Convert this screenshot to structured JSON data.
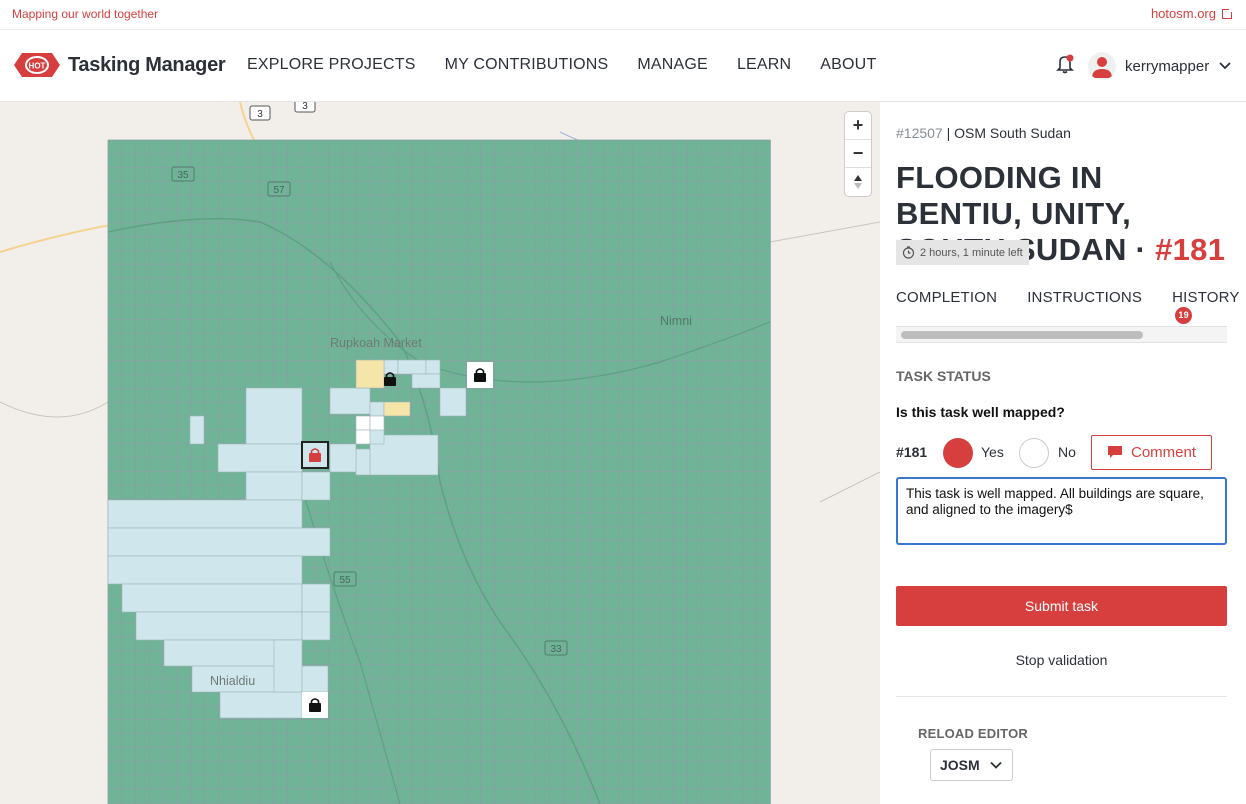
{
  "top": {
    "tagline": "Mapping our world together",
    "hotosm": "hotosm.org"
  },
  "header": {
    "brand": "Tasking Manager",
    "logo_text": "HOT",
    "nav": [
      "EXPLORE PROJECTS",
      "MY CONTRIBUTIONS",
      "MANAGE",
      "LEARN",
      "ABOUT"
    ],
    "username": "kerrymapper"
  },
  "map": {
    "labels": {
      "town1": "Rupkoah Market",
      "town2": "Nimni",
      "town3": "Nhialdiu"
    },
    "road_shields": [
      "3",
      "3",
      "35",
      "57",
      "55",
      "33"
    ],
    "controls": {
      "zoom_in": "+",
      "zoom_out": "−"
    }
  },
  "panel": {
    "project_id": "#12507",
    "project_sep": " | ",
    "project_org": "OSM South Sudan",
    "title": "FLOODING IN BENTIU, UNITY, SOUTH SUDAN",
    "title_sep": " · ",
    "task_num": "#181",
    "timer": "2 hours, 1 minute left",
    "tabs": {
      "completion": "COMPLETION",
      "instructions": "INSTRUCTIONS",
      "history": "HISTORY",
      "history_count": "19"
    },
    "task_status": "TASK STATUS",
    "question": "Is this task well mapped?",
    "task_label": "#181",
    "yes": "Yes",
    "no": "No",
    "comment_button": "Comment",
    "comment_text": "This task is well mapped. All buildings are square, and aligned to the imagery$",
    "submit": "Submit task",
    "stop_validation": "Stop validation",
    "reload_editor": "RELOAD EDITOR",
    "editor": "JOSM"
  },
  "colors": {
    "brand_red": "#d73f3f",
    "grid_green": "#6fb497",
    "mapped_blue": "#cfe6ec",
    "locked_yellow": "#f6e5a8"
  }
}
